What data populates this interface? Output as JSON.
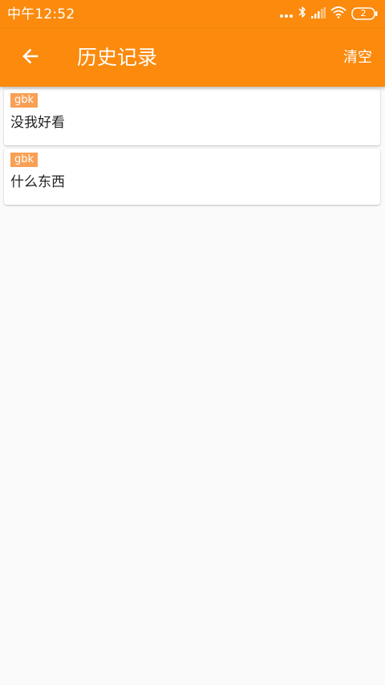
{
  "status_bar": {
    "time": "中午12:52",
    "battery": "2"
  },
  "app_bar": {
    "back_icon": "arrow-left-icon",
    "title": "历史记录",
    "clear_label": "清空"
  },
  "history": [
    {
      "encoding": "gbk",
      "text": "没我好看"
    },
    {
      "encoding": "gbk",
      "text": "什么东西"
    }
  ],
  "colors": {
    "primary": "#fb8a0d",
    "badge": "#f9a055",
    "background": "#fafafa"
  }
}
